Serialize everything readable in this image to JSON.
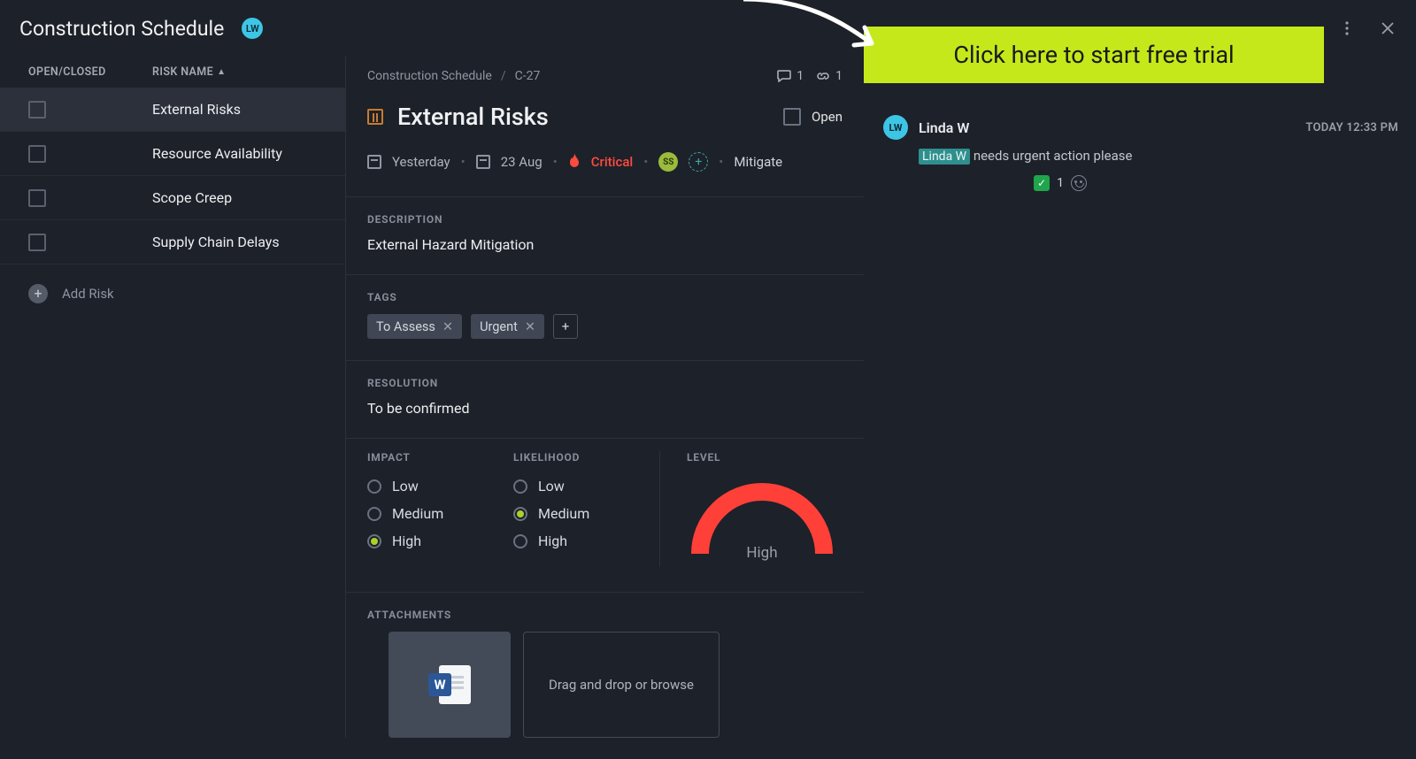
{
  "header": {
    "title": "Construction Schedule",
    "avatar_initials": "LW"
  },
  "sidebar": {
    "col_open": "OPEN/CLOSED",
    "col_name": "RISK NAME",
    "rows": [
      {
        "name": "External Risks",
        "selected": true
      },
      {
        "name": "Resource Availability"
      },
      {
        "name": "Scope Creep"
      },
      {
        "name": "Supply Chain Delays"
      }
    ],
    "add_label": "Add Risk"
  },
  "detail": {
    "crumb_parent": "Construction Schedule",
    "crumb_id": "C-27",
    "comments_count": "1",
    "links_count": "1",
    "title": "External Risks",
    "open_label": "Open",
    "meta": {
      "date_start": "Yesterday",
      "date_end": "23 Aug",
      "priority_label": "Critical",
      "assignee_initials": "SS",
      "status_label": "Mitigate"
    },
    "sections": {
      "description_label": "DESCRIPTION",
      "description_value": "External Hazard Mitigation",
      "tags_label": "TAGS",
      "tags": [
        {
          "label": "To Assess"
        },
        {
          "label": "Urgent"
        }
      ],
      "resolution_label": "RESOLUTION",
      "resolution_value": "To be confirmed",
      "impact_label": "IMPACT",
      "likelihood_label": "LIKELIHOOD",
      "level_label": "LEVEL",
      "options": {
        "low": "Low",
        "medium": "Medium",
        "high": "High"
      },
      "impact_selected": "high",
      "likelihood_selected": "medium",
      "level_value": "High",
      "attachments_label": "ATTACHMENTS",
      "dropzone_text": "Drag and drop or browse",
      "word_badge": "W"
    }
  },
  "comments": {
    "trial_cta": "Click here to start free trial",
    "author": "Linda W",
    "timestamp": "TODAY 12:33 PM",
    "mention": "Linda W",
    "body_rest": " needs urgent action please",
    "reaction_count": "1"
  }
}
